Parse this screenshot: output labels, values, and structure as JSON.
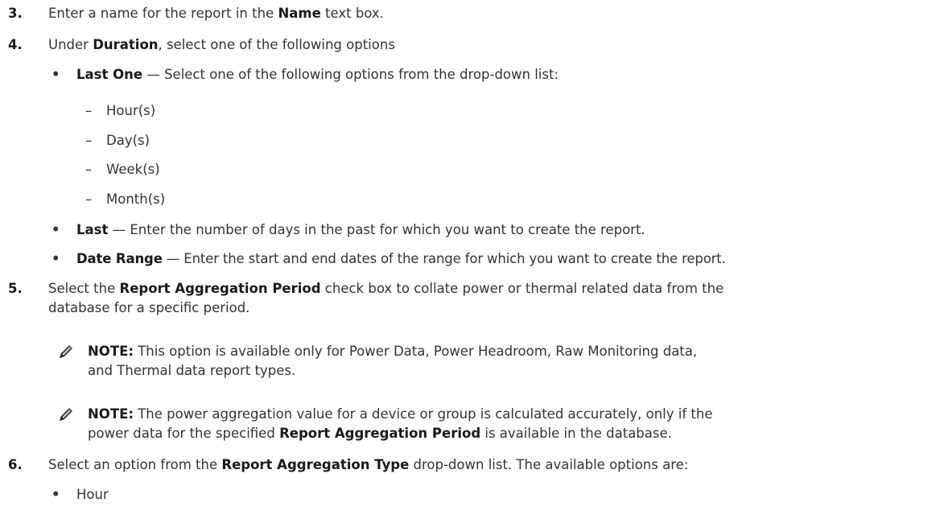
{
  "steps": {
    "s3": {
      "num": "3.",
      "pre": "Enter a name for the report in the ",
      "bold": "Name",
      "post": " text box."
    },
    "s4": {
      "num": "4.",
      "pre": "Under ",
      "bold": "Duration",
      "post": ", select one of the following options",
      "bullets": [
        {
          "mark": "•",
          "bold": "Last One",
          "text": " — Select one of the following options from the drop-down list:"
        },
        {
          "mark": "•",
          "bold": "Last",
          "text": " — Enter the number of days in the past for which you want to create the report."
        },
        {
          "mark": "•",
          "bold": "Date Range",
          "text": " — Enter the start and end dates of the range for which you want to create the report."
        }
      ],
      "dash_mark": "–",
      "options": [
        "Hour(s)",
        "Day(s)",
        "Week(s)",
        "Month(s)"
      ]
    },
    "s5": {
      "num": "5.",
      "pre": "Select the ",
      "bold": "Report Aggregation Period",
      "post": " check box to collate power or thermal related data from the",
      "line2": "database for a specific period.",
      "notes": [
        {
          "label": "NOTE:",
          "line1": " This option is available only for Power Data, Power Headroom, Raw Monitoring data,",
          "line2": "and Thermal data report types."
        },
        {
          "label": "NOTE:",
          "line1": " The power aggregation value for a device or group is calculated accurately, only if the",
          "line2_pre": "power data for the specified ",
          "line2_bold": "Report Aggregation Period",
          "line2_post": " is available in the database."
        }
      ]
    },
    "s6": {
      "num": "6.",
      "pre": "Select an option from the ",
      "bold": "Report Aggregation Type",
      "post": " drop-down list. The available options are:",
      "bullets": [
        {
          "mark": "•",
          "text": "Hour"
        }
      ]
    }
  },
  "icons": {
    "note": "pencil-note-icon"
  }
}
